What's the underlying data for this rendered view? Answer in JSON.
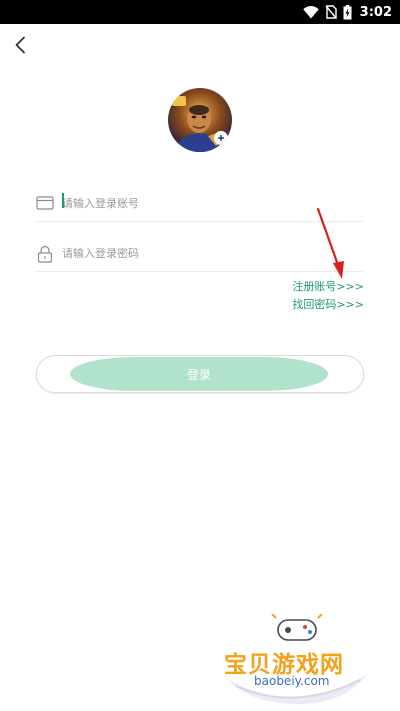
{
  "status_bar": {
    "time": "3:02",
    "icons": [
      "wifi-icon",
      "no-sim-icon",
      "battery-charging-icon"
    ]
  },
  "header": {
    "back_icon": "chevron-left-icon"
  },
  "form": {
    "account_placeholder": "请输入登录账号",
    "password_placeholder": "请输入登录密码",
    "account_icon": "card-icon",
    "password_icon": "lock-icon"
  },
  "links": {
    "register": "注册账号>>>",
    "find_password": "找回密码>>>"
  },
  "login_button": {
    "label": "登录"
  },
  "watermark": {
    "title": "宝贝游戏网",
    "url": "baobeiy.com"
  },
  "colors": {
    "accent_green": "#1f9a68",
    "button_fill": "#b1e3cc",
    "annotation_red": "#d81e1e"
  }
}
